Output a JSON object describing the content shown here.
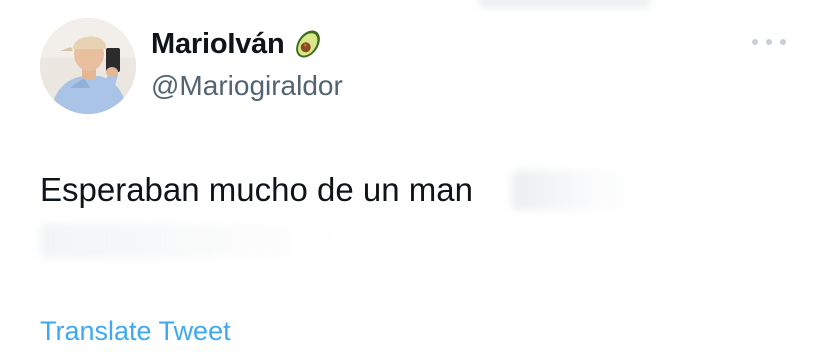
{
  "tweet": {
    "display_name": "MarioIván",
    "name_emoji_icon": "avocado-icon",
    "handle": "@Mariogiraldor",
    "text_visible": "Esperaban mucho de un man",
    "translate_label": "Translate Tweet",
    "more_icon": "more-options-icon"
  },
  "colors": {
    "name": "#0f1419",
    "handle": "#536471",
    "link": "#1d9bf0",
    "more_dots": "#c8cfd5"
  }
}
